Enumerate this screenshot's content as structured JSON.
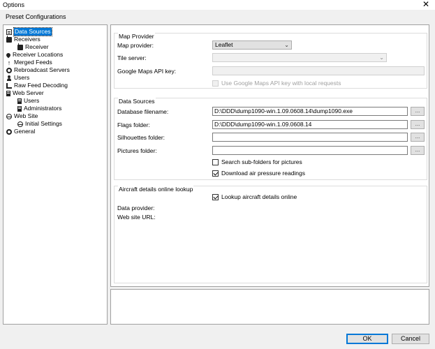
{
  "window": {
    "title": "Options",
    "close_glyph": "✕"
  },
  "menu": {
    "preset": "Preset Configurations"
  },
  "tree": {
    "items": [
      {
        "label": "Data Sources",
        "icon": "document-icon"
      },
      {
        "label": "Receivers",
        "icon": "radio-icon"
      },
      {
        "label": "Receiver",
        "icon": "radio-icon"
      },
      {
        "label": "Receiver Locations",
        "icon": "location-pin-icon"
      },
      {
        "label": "Merged Feeds",
        "icon": "merge-arrow-icon"
      },
      {
        "label": "Rebroadcast Servers",
        "icon": "gear-icon"
      },
      {
        "label": "Users",
        "icon": "user-icon"
      },
      {
        "label": "Raw Feed Decoding",
        "icon": "wave-icon"
      },
      {
        "label": "Web Server",
        "icon": "server-icon"
      },
      {
        "label": "Users",
        "icon": "server-icon"
      },
      {
        "label": "Administrators",
        "icon": "server-icon"
      },
      {
        "label": "Web Site",
        "icon": "globe-icon"
      },
      {
        "label": "Initial Settings",
        "icon": "globe-icon"
      },
      {
        "label": "General",
        "icon": "gear-icon"
      }
    ]
  },
  "map_provider": {
    "title": "Map Provider",
    "provider_label": "Map provider:",
    "provider_value": "Leaflet",
    "tile_label": "Tile server:",
    "tile_value": "",
    "api_key_label": "Google Maps API key:",
    "api_key_value": "",
    "local_key_label": "Use Google Maps API key with local requests",
    "local_key_checked": false
  },
  "data_sources": {
    "title": "Data Sources",
    "db_label": "Database filename:",
    "db_value": "D:\\DDD\\dump1090-win.1.09.0608.14\\dump1090.exe",
    "flags_label": "Flags folder:",
    "flags_value": "D:\\DDD\\dump1090-win.1.09.0608.14",
    "silhouettes_label": "Silhouettes folder:",
    "silhouettes_value": "",
    "pictures_label": "Pictures folder:",
    "pictures_value": "",
    "browse_label": "...",
    "subfolders_label": "Search sub-folders for pictures",
    "subfolders_checked": false,
    "pressure_label": "Download air pressure readings",
    "pressure_checked": true
  },
  "lookup": {
    "title": "Aircraft details online lookup",
    "online_label": "Lookup aircraft details online",
    "online_checked": true,
    "provider_label": "Data provider:",
    "url_label": "Web site URL:"
  },
  "buttons": {
    "ok": "OK",
    "cancel": "Cancel"
  }
}
